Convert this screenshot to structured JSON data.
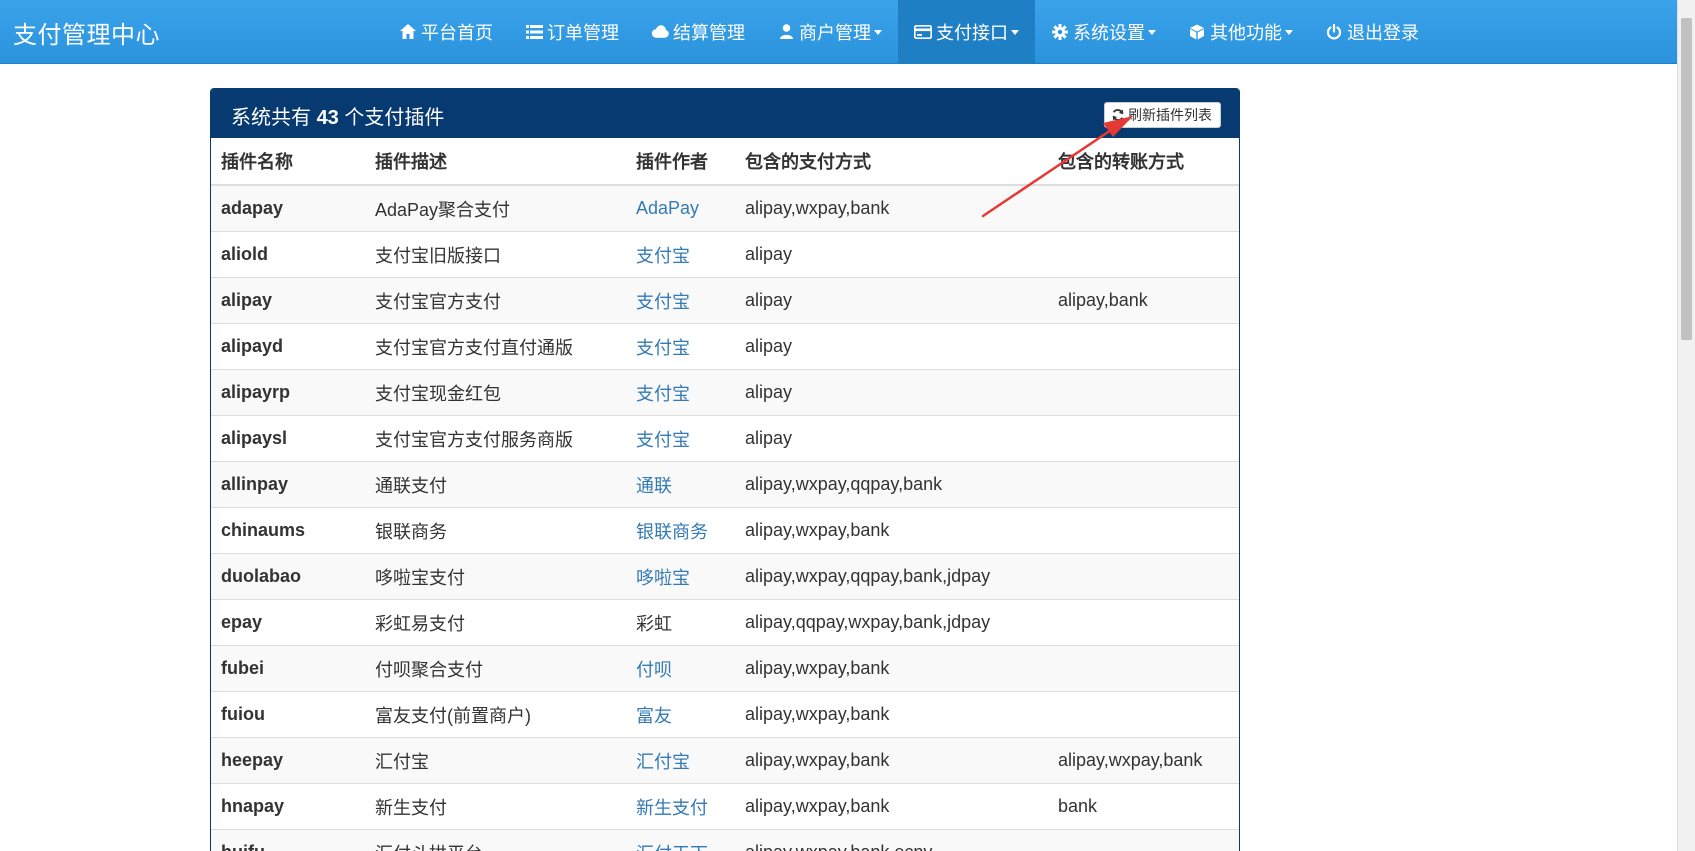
{
  "brand": "支付管理中心",
  "nav": [
    {
      "label": "平台首页",
      "icon": "home-icon",
      "dropdown": false,
      "active": false
    },
    {
      "label": "订单管理",
      "icon": "list-icon",
      "dropdown": false,
      "active": false
    },
    {
      "label": "结算管理",
      "icon": "cloud-icon",
      "dropdown": false,
      "active": false
    },
    {
      "label": "商户管理",
      "icon": "user-icon",
      "dropdown": true,
      "active": false
    },
    {
      "label": "支付接口",
      "icon": "credit-card-icon",
      "dropdown": true,
      "active": true
    },
    {
      "label": "系统设置",
      "icon": "gear-icon",
      "dropdown": true,
      "active": false
    },
    {
      "label": "其他功能",
      "icon": "cube-icon",
      "dropdown": true,
      "active": false
    },
    {
      "label": "退出登录",
      "icon": "power-icon",
      "dropdown": false,
      "active": false
    }
  ],
  "panel": {
    "title_prefix": "系统共有",
    "count": "43",
    "title_suffix": "个支付插件",
    "refresh_label": "刷新插件列表"
  },
  "table": {
    "headers": [
      "插件名称",
      "插件描述",
      "插件作者",
      "包含的支付方式",
      "包含的转账方式"
    ],
    "rows": [
      {
        "name": "adapay",
        "desc": "AdaPay聚合支付",
        "author": "AdaPay",
        "author_link": true,
        "pay": "alipay,wxpay,bank",
        "transfer": ""
      },
      {
        "name": "aliold",
        "desc": "支付宝旧版接口",
        "author": "支付宝",
        "author_link": true,
        "pay": "alipay",
        "transfer": ""
      },
      {
        "name": "alipay",
        "desc": "支付宝官方支付",
        "author": "支付宝",
        "author_link": true,
        "pay": "alipay",
        "transfer": "alipay,bank"
      },
      {
        "name": "alipayd",
        "desc": "支付宝官方支付直付通版",
        "author": "支付宝",
        "author_link": true,
        "pay": "alipay",
        "transfer": ""
      },
      {
        "name": "alipayrp",
        "desc": "支付宝现金红包",
        "author": "支付宝",
        "author_link": true,
        "pay": "alipay",
        "transfer": ""
      },
      {
        "name": "alipaysl",
        "desc": "支付宝官方支付服务商版",
        "author": "支付宝",
        "author_link": true,
        "pay": "alipay",
        "transfer": ""
      },
      {
        "name": "allinpay",
        "desc": "通联支付",
        "author": "通联",
        "author_link": true,
        "pay": "alipay,wxpay,qqpay,bank",
        "transfer": ""
      },
      {
        "name": "chinaums",
        "desc": "银联商务",
        "author": "银联商务",
        "author_link": true,
        "pay": "alipay,wxpay,bank",
        "transfer": ""
      },
      {
        "name": "duolabao",
        "desc": "哆啦宝支付",
        "author": "哆啦宝",
        "author_link": true,
        "pay": "alipay,wxpay,qqpay,bank,jdpay",
        "transfer": ""
      },
      {
        "name": "epay",
        "desc": "彩虹易支付",
        "author": "彩虹",
        "author_link": false,
        "pay": "alipay,qqpay,wxpay,bank,jdpay",
        "transfer": ""
      },
      {
        "name": "fubei",
        "desc": "付呗聚合支付",
        "author": "付呗",
        "author_link": true,
        "pay": "alipay,wxpay,bank",
        "transfer": ""
      },
      {
        "name": "fuiou",
        "desc": "富友支付(前置商户)",
        "author": "富友",
        "author_link": true,
        "pay": "alipay,wxpay,bank",
        "transfer": ""
      },
      {
        "name": "heepay",
        "desc": "汇付宝",
        "author": "汇付宝",
        "author_link": true,
        "pay": "alipay,wxpay,bank",
        "transfer": "alipay,wxpay,bank"
      },
      {
        "name": "hnapay",
        "desc": "新生支付",
        "author": "新生支付",
        "author_link": true,
        "pay": "alipay,wxpay,bank",
        "transfer": "bank"
      },
      {
        "name": "huifu",
        "desc": "汇付斗拱平台",
        "author": "汇付天下",
        "author_link": true,
        "pay": "alipay,wxpay,bank,ecny",
        "transfer": ""
      }
    ]
  },
  "colors": {
    "navbar": "#2a93dd",
    "nav_active": "#1f7fc4",
    "panel_heading": "#063a70",
    "link": "#337ab7",
    "annotation_arrow": "#e53935"
  }
}
